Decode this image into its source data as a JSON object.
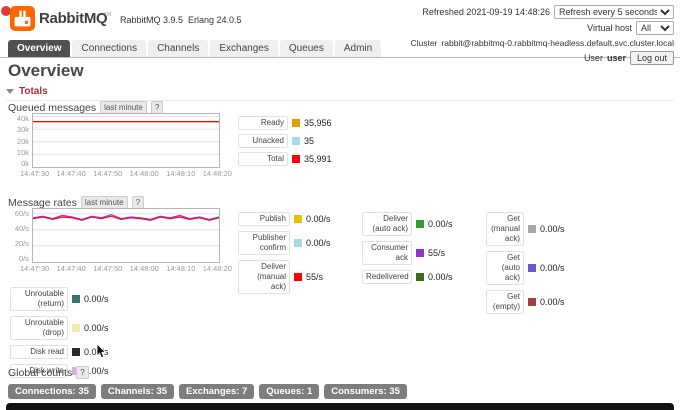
{
  "header": {
    "brand": "RabbitMQ",
    "brand_tm": "TM",
    "product_version": "RabbitMQ 3.9.5",
    "erlang_version": "Erlang 24.0.5",
    "refreshed": "Refreshed 2021-09-19 14:48:26",
    "refresh_interval": "Refresh every 5 seconds",
    "virtual_host_label": "Virtual host",
    "virtual_host_value": "All",
    "cluster_label": "Cluster",
    "cluster_name": "rabbit@rabbitmq-0.rabbitmq-headless.default.svc.cluster.local",
    "user_label": "User",
    "username": "user",
    "logout": "Log out"
  },
  "nav": {
    "tabs": [
      {
        "label": "Overview",
        "active": true
      },
      {
        "label": "Connections",
        "active": false
      },
      {
        "label": "Channels",
        "active": false
      },
      {
        "label": "Exchanges",
        "active": false
      },
      {
        "label": "Queues",
        "active": false
      },
      {
        "label": "Admin",
        "active": false
      }
    ]
  },
  "page": {
    "title": "Overview",
    "totals_heading": "Totals",
    "global_counts_heading": "Global counts",
    "range_badge": "last minute",
    "help_badge": "?"
  },
  "queued_messages": {
    "heading": "Queued messages",
    "legend": [
      {
        "label": "Ready",
        "color": "#dca300",
        "value": "35,956"
      },
      {
        "label": "Unacked",
        "color": "#a8d8e8",
        "value": "35"
      },
      {
        "label": "Total",
        "color": "#ff0000",
        "value": "35,991"
      }
    ]
  },
  "message_rates": {
    "heading": "Message rates",
    "legend_columns": [
      [
        {
          "label": "Publish",
          "color": "#e4c200",
          "value": "0.00/s"
        },
        {
          "label": "Publisher confirm",
          "color": "#a8d8e8",
          "value": "0.00/s"
        },
        {
          "label": "Deliver (manual ack)",
          "color": "#ff0000",
          "value": "55/s"
        }
      ],
      [
        {
          "label": "Deliver (auto ack)",
          "color": "#2f9e2f",
          "value": "0.00/s"
        },
        {
          "label": "Consumer ack",
          "color": "#9436c9",
          "value": "55/s"
        },
        {
          "label": "Redelivered",
          "color": "#3d6b22",
          "value": "0.00/s"
        }
      ],
      [
        {
          "label": "Get (manual ack)",
          "color": "#a6a6a6",
          "value": "0.00/s"
        },
        {
          "label": "Get (auto ack)",
          "color": "#6a5acd",
          "value": "0.00/s"
        },
        {
          "label": "Get (empty)",
          "color": "#9e4040",
          "value": "0.00/s"
        }
      ]
    ],
    "legend_extra": [
      {
        "label": "Unroutable (return)",
        "color": "#3f7070",
        "value": "0.00/s"
      },
      {
        "label": "Unroutable (drop)",
        "color": "#eeeeb0",
        "value": "0.00/s"
      },
      {
        "label": "Disk read",
        "color": "#2b2b2b",
        "value": "0.00/s"
      },
      {
        "label": "Disk write",
        "color": "#d5aee0",
        "value": "0.00/s"
      }
    ]
  },
  "chart_data": [
    {
      "type": "line",
      "title": "Queued messages (last minute)",
      "x_ticks": [
        "14:47:30",
        "14:47:40",
        "14:47:50",
        "14:48:00",
        "14:48:10",
        "14:48:20"
      ],
      "y_ticks": [
        "40k",
        "30k",
        "20k",
        "10k",
        "0k"
      ],
      "ylim": [
        0,
        42000
      ],
      "grid_values": [
        10000,
        20000,
        30000,
        40000
      ],
      "series": [
        {
          "name": "Ready",
          "color": "#dca300",
          "values": [
            35956,
            35956,
            35956,
            35956,
            35956,
            35956,
            35956,
            35956,
            35956,
            35956,
            35956,
            35956,
            35956
          ]
        },
        {
          "name": "Total",
          "color": "#ff0000",
          "values": [
            35991,
            35991,
            35991,
            35991,
            35991,
            35991,
            35991,
            35991,
            35991,
            35991,
            35991,
            35991,
            35991
          ]
        }
      ]
    },
    {
      "type": "line",
      "title": "Message rates (last minute)",
      "x_ticks": [
        "14:47:30",
        "14:47:40",
        "14:47:50",
        "14:48:00",
        "14:48:10",
        "14:48:20"
      ],
      "y_ticks": [
        "60/s",
        "40/s",
        "20/s",
        "0/s"
      ],
      "ylim": [
        0,
        66
      ],
      "grid_values": [
        20,
        40,
        60
      ],
      "series": [
        {
          "name": "Deliver (manual ack)",
          "color": "#ff0000",
          "values": [
            54,
            56,
            53,
            56,
            55,
            52,
            56,
            54,
            57,
            53,
            55,
            54,
            52,
            56,
            54,
            56,
            53,
            55,
            52,
            55
          ]
        },
        {
          "name": "Consumer ack",
          "color": "#9436c9",
          "values": [
            55,
            57,
            54,
            58,
            56,
            53,
            57,
            55,
            59,
            54,
            56,
            55,
            53,
            57,
            55,
            58,
            54,
            56,
            53,
            56
          ]
        }
      ]
    }
  ],
  "footer": {
    "badges": [
      "Connections: 35",
      "Channels: 35",
      "Exchanges: 7",
      "Queues: 1",
      "Consumers: 35"
    ]
  }
}
